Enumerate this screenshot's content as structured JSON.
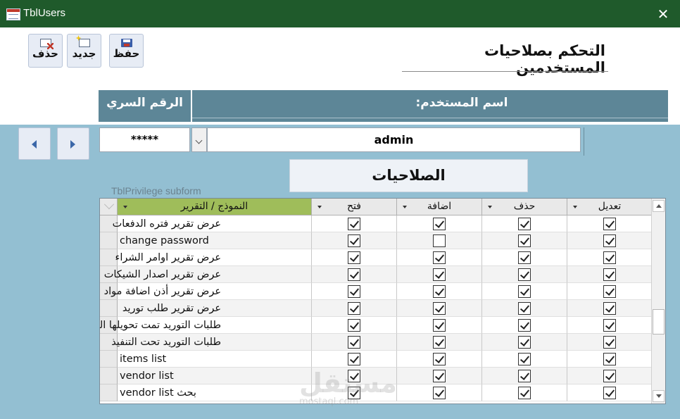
{
  "window": {
    "title": "TblUsers",
    "close_glyph": "✕",
    "icon": "table-icon"
  },
  "toolbar": {
    "save_label": "حفظ",
    "new_label": "جديد",
    "delete_label": "حذف",
    "icons": [
      "save-icon",
      "new-record-icon",
      "delete-record-icon"
    ]
  },
  "form": {
    "title": "التحكم بصلاحيات المستخدمين",
    "password_header": "الرقم السري",
    "username_header": "اسم المستخدم:",
    "password_value": "*****",
    "username_value": "admin",
    "privileges_title": "الصلاحيات",
    "subform_label": "TblPrivilege subform"
  },
  "grid": {
    "columns": [
      {
        "label": "النموذج / التقرير"
      },
      {
        "label": "فتح"
      },
      {
        "label": "اضافة"
      },
      {
        "label": "حذف"
      },
      {
        "label": "تعديل"
      }
    ],
    "rows": [
      {
        "name": "عرض تقرير فتره الدفعات",
        "open": true,
        "add": true,
        "delete": true,
        "edit": true
      },
      {
        "name": "change password",
        "open": true,
        "add": false,
        "delete": true,
        "edit": true
      },
      {
        "name": "عرض تقرير اوامر الشراء",
        "open": true,
        "add": true,
        "delete": true,
        "edit": true
      },
      {
        "name": "عرض تقرير اصدار الشيكات",
        "open": true,
        "add": true,
        "delete": true,
        "edit": true
      },
      {
        "name": "عرض تقرير أذن اضافة مواد",
        "open": true,
        "add": true,
        "delete": true,
        "edit": true
      },
      {
        "name": "عرض تقرير  طلب توريد",
        "open": true,
        "add": true,
        "delete": true,
        "edit": true
      },
      {
        "name": "طلبات التوريد تمت تحويلها الى اوامر الشراء",
        "open": true,
        "add": true,
        "delete": true,
        "edit": true
      },
      {
        "name": "طلبات التوريد تحت التنفيذ",
        "open": true,
        "add": true,
        "delete": true,
        "edit": true
      },
      {
        "name": "items list",
        "open": true,
        "add": true,
        "delete": true,
        "edit": true
      },
      {
        "name": "vendor list",
        "open": true,
        "add": true,
        "delete": true,
        "edit": true
      },
      {
        "name": "vendor list بحث",
        "open": true,
        "add": true,
        "delete": true,
        "edit": true
      }
    ]
  },
  "colors": {
    "titlebar": "#1f5a2b",
    "header_band": "#5d8697",
    "body_bg": "#93bfd2",
    "active_header": "#9fbd5a"
  },
  "watermark": {
    "text": "مستقل",
    "sub": "mostaql.com"
  }
}
